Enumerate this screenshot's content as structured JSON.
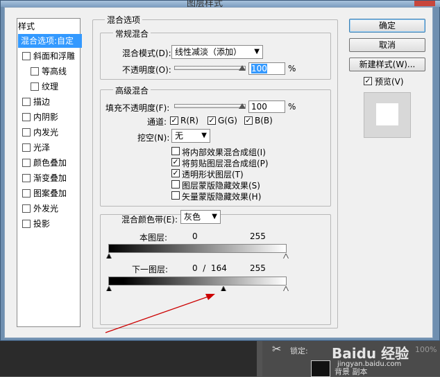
{
  "dialog": {
    "title": "图层样式",
    "styles_header": "样式",
    "style_items": [
      {
        "label": "混合选项:自定",
        "checkbox": false,
        "selected": true,
        "sub": false
      },
      {
        "label": "斜面和浮雕",
        "checkbox": true,
        "selected": false,
        "sub": false
      },
      {
        "label": "等高线",
        "checkbox": true,
        "selected": false,
        "sub": true
      },
      {
        "label": "纹理",
        "checkbox": true,
        "selected": false,
        "sub": true
      },
      {
        "label": "描边",
        "checkbox": true,
        "selected": false,
        "sub": false
      },
      {
        "label": "内阴影",
        "checkbox": true,
        "selected": false,
        "sub": false
      },
      {
        "label": "内发光",
        "checkbox": true,
        "selected": false,
        "sub": false
      },
      {
        "label": "光泽",
        "checkbox": true,
        "selected": false,
        "sub": false
      },
      {
        "label": "颜色叠加",
        "checkbox": true,
        "selected": false,
        "sub": false
      },
      {
        "label": "渐变叠加",
        "checkbox": true,
        "selected": false,
        "sub": false
      },
      {
        "label": "图案叠加",
        "checkbox": true,
        "selected": false,
        "sub": false
      },
      {
        "label": "外发光",
        "checkbox": true,
        "selected": false,
        "sub": false
      },
      {
        "label": "投影",
        "checkbox": true,
        "selected": false,
        "sub": false
      }
    ],
    "blend_options_title": "混合选项",
    "general": {
      "title": "常规混合",
      "mode_label": "混合模式(D):",
      "mode_value": "线性减淡（添加）",
      "opacity_label": "不透明度(O):",
      "opacity_value": "100",
      "opacity_unit": "%"
    },
    "advanced": {
      "title": "高级混合",
      "fill_label": "填充不透明度(F):",
      "fill_value": "100",
      "fill_unit": "%",
      "channels_label": "通道:",
      "channel_r": "R(R)",
      "channel_g": "G(G)",
      "channel_b": "B(B)",
      "knockout_label": "挖空(N):",
      "knockout_value": "无",
      "options": [
        {
          "label": "将内部效果混合成组(I)",
          "checked": false
        },
        {
          "label": "将剪贴图层混合成组(P)",
          "checked": true
        },
        {
          "label": "透明形状图层(T)",
          "checked": true
        },
        {
          "label": "图层蒙版隐藏效果(S)",
          "checked": false
        },
        {
          "label": "矢量蒙版隐藏效果(H)",
          "checked": false
        }
      ]
    },
    "blend_if": {
      "label": "混合颜色带(E):",
      "value": "灰色",
      "this_layer_label": "本图层:",
      "this_layer_low": "0",
      "this_layer_high": "255",
      "underlying_label": "下一图层:",
      "underlying_text": "0  /  164",
      "underlying_high": "255"
    },
    "buttons": {
      "ok": "确定",
      "cancel": "取消",
      "new_style": "新建样式(W)...",
      "preview": "预览(V)"
    }
  },
  "background": {
    "lock_label": "锁定:",
    "opacity_fragment": "100%",
    "layer_name": "背景 副本"
  },
  "watermark": {
    "text": "Baidu 经验",
    "url": "jingyan.baidu.com"
  },
  "colors": {
    "selection": "#3399ff",
    "arrow": "#cc0000"
  }
}
